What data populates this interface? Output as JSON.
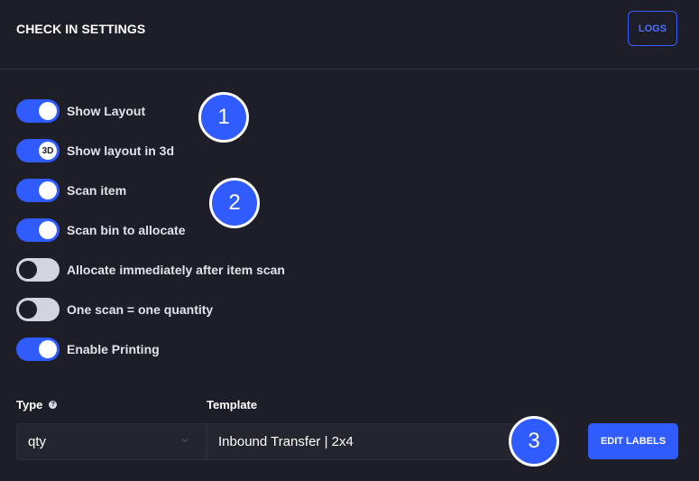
{
  "header": {
    "title": "CHECK IN SETTINGS",
    "logs_label": "LOGS"
  },
  "toggles": [
    {
      "label": "Show Layout",
      "on": true,
      "knob_text": ""
    },
    {
      "label": "Show layout in 3d",
      "on": true,
      "knob_text": "3D"
    },
    {
      "label": "Scan item",
      "on": true,
      "knob_text": ""
    },
    {
      "label": "Scan bin to allocate",
      "on": true,
      "knob_text": ""
    },
    {
      "label": "Allocate immediately after item scan",
      "on": false,
      "knob_text": ""
    },
    {
      "label": "One scan = one quantity",
      "on": false,
      "knob_text": ""
    },
    {
      "label": "Enable Printing",
      "on": true,
      "knob_text": ""
    }
  ],
  "badges": [
    "1",
    "2",
    "3"
  ],
  "form": {
    "type_label": "Type",
    "type_help_icon": "?",
    "type_value": "qty",
    "template_label": "Template",
    "template_value": "Inbound Transfer | 2x4",
    "edit_labels": "EDIT LABELS"
  },
  "colors": {
    "background": "#1e1e28",
    "accent": "#2f5bff",
    "toggle_off": "#d4d4dc"
  }
}
